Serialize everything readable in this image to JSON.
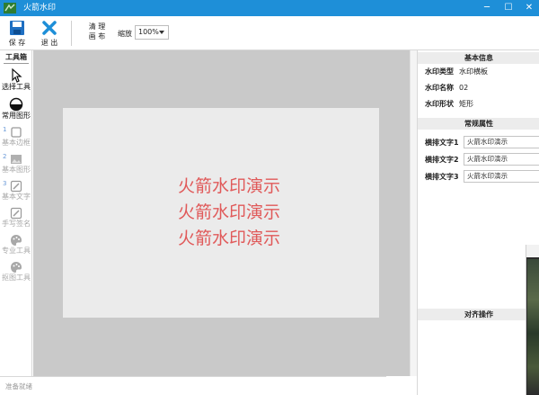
{
  "window": {
    "title": "火箭水印",
    "controls": {
      "minimize": "─",
      "maximize": "☐",
      "close": "✕"
    }
  },
  "toolbar": {
    "save_label": "保 存",
    "exit_label": "退 出",
    "layout_label_line1": "清 理",
    "layout_label_line2": "画 布",
    "zoom_label": "缩放",
    "zoom_value": "100%"
  },
  "left_panel": {
    "header": "工具箱",
    "tools": [
      {
        "label": "选择工具",
        "enabled": true,
        "icon": "cursor-icon"
      },
      {
        "label": "常用图形",
        "enabled": true,
        "icon": "shape-icon"
      },
      {
        "num": "1",
        "label": "基本边框",
        "enabled": false,
        "icon": "frame-icon"
      },
      {
        "num": "2",
        "label": "基本图形",
        "enabled": false,
        "icon": "image-icon"
      },
      {
        "num": "3",
        "label": "基本文字",
        "enabled": false,
        "icon": "pen-icon"
      },
      {
        "label": "手写签名",
        "enabled": false,
        "icon": "signature-icon"
      },
      {
        "label": "专业工具",
        "enabled": false,
        "icon": "palette-icon"
      },
      {
        "label": "抠图工具",
        "enabled": false,
        "icon": "palette-icon"
      }
    ]
  },
  "canvas": {
    "watermark_lines": [
      "火箭水印演示",
      "火箭水印演示",
      "火箭水印演示"
    ],
    "watermark_color": "#e05959"
  },
  "right_panel": {
    "basic_info_title": "基本信息",
    "basic_info": [
      {
        "key": "水印类型",
        "value": "水印横板"
      },
      {
        "key": "水印名称",
        "value": "02"
      },
      {
        "key": "水印形状",
        "value": "矩形"
      }
    ],
    "general_title": "常规属性",
    "properties": [
      {
        "key": "横排文字1",
        "value": "火箭水印演示"
      },
      {
        "key": "横排文字2",
        "value": "火箭水印演示"
      },
      {
        "key": "横排文字3",
        "value": "火箭水印演示"
      }
    ],
    "align_title": "对齐操作"
  },
  "status": {
    "text": "准备就绪"
  },
  "colors": {
    "titlebar": "#1e8fd8",
    "accent": "#1e8fd8",
    "canvas_bg": "#c9c9c9",
    "page_bg": "#ebebeb"
  }
}
